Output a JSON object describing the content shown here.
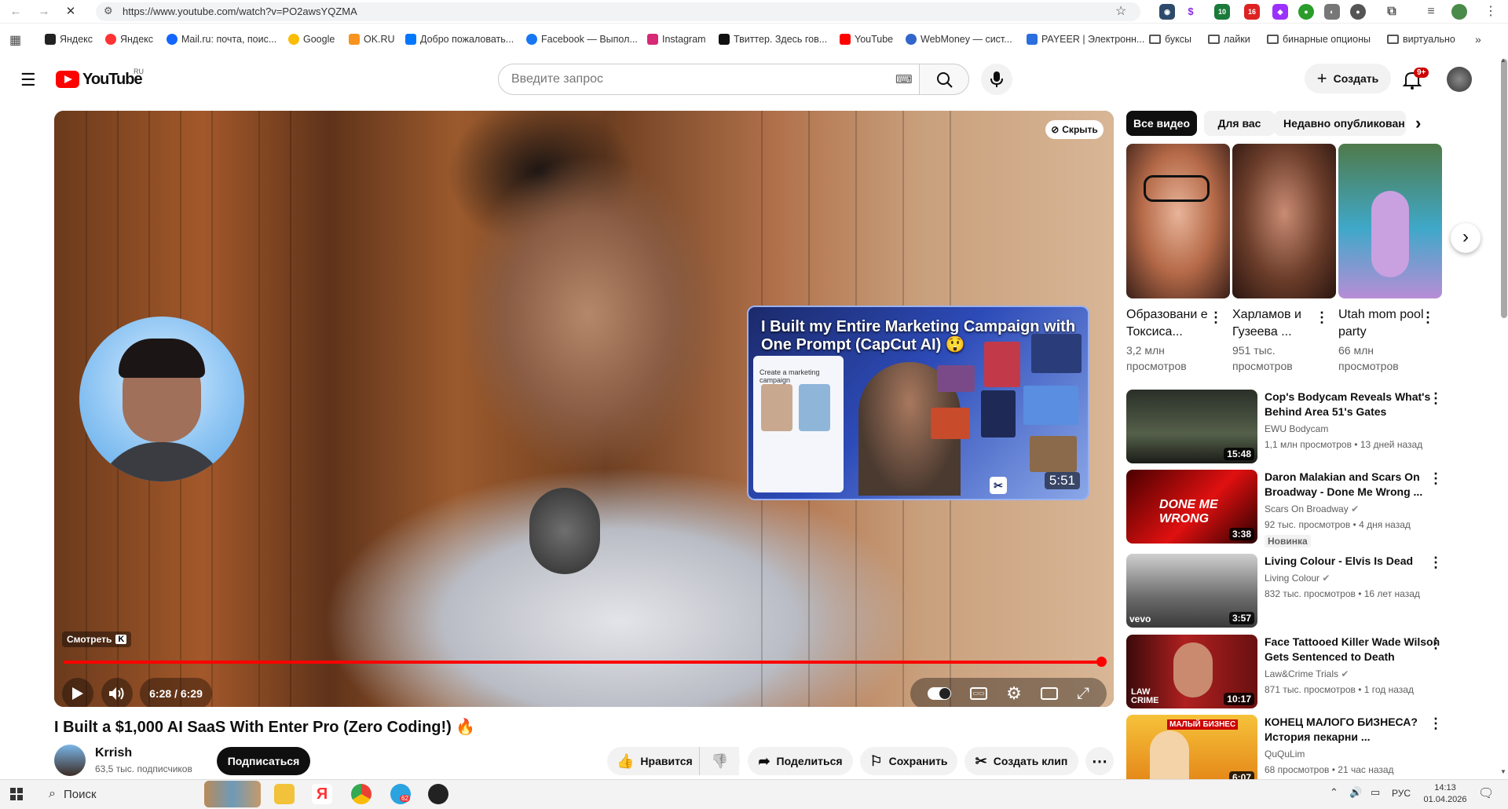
{
  "browser": {
    "url": "https://www.youtube.com/watch?v=PO2awsYQZMA",
    "bookmarks": [
      "Яндекс",
      "Яндекс",
      "Mail.ru: почта, поис...",
      "Google",
      "OK.RU",
      "Добро пожаловать...",
      "Facebook — Выпол...",
      "Instagram",
      "Твиттер. Здесь гов...",
      "YouTube",
      "WebMoney — сист...",
      "PAYEER | Электронн...",
      "буксы",
      "лайки",
      "бинарные опционы",
      "виртуально"
    ],
    "ext_badges": [
      "10",
      "16"
    ]
  },
  "header": {
    "logo_text": "YouTube",
    "logo_region": "RU",
    "search_placeholder": "Введите запрос",
    "create_label": "Создать",
    "notif_badge": "9+"
  },
  "player": {
    "hide_label": "Скрыть",
    "watch_label": "Смотреть",
    "watch_key": "K",
    "time": "6:28 / 6:29",
    "endcard_title": "I Built my Entire Marketing Campaign with One Prompt (CapCut AI) 😲",
    "endcard_duration": "5:51",
    "endcard_panel_text": "Create a marketing campaign",
    "progress": 0.997
  },
  "video": {
    "title": "I Built a $1,000 AI SaaS With Enter Pro (Zero Coding!) 🔥",
    "channel": "Krrish",
    "subscribers": "63,5 тыс. подписчиков",
    "subscribe_label": "Подписаться",
    "like_label": "Нравится",
    "share_label": "Поделиться",
    "save_label": "Сохранить",
    "clip_label": "Создать клип"
  },
  "sidebar": {
    "chips": [
      "Все видео",
      "Для вас",
      "Недавно опубликован"
    ],
    "shorts": [
      {
        "title": "Образовани е Токсиса...",
        "meta": "3,2 млн просмотров"
      },
      {
        "title": "Харламов и Гузеева ...",
        "meta": "951 тыс. просмотров"
      },
      {
        "title": "Utah mom pool party",
        "meta": "66 млн просмотров"
      }
    ],
    "recs": [
      {
        "title": "Cop's Bodycam Reveals What's Behind Area 51's Gates",
        "channel": "EWU Bodycam",
        "meta": "1,1 млн просмотров • 13 дней назад",
        "duration": "15:48",
        "badge": ""
      },
      {
        "title": "Daron Malakian and Scars On Broadway - Done Me Wrong ...",
        "channel": "Scars On Broadway",
        "meta": "92 тыс. просмотров • 4 дня назад",
        "duration": "3:38",
        "badge": "Новинка"
      },
      {
        "title": "Living Colour - Elvis Is Dead",
        "channel": "Living Colour",
        "meta": "832 тыс. просмотров • 16 лет назад",
        "duration": "3:57",
        "badge": ""
      },
      {
        "title": "Face Tattooed Killer Wade Wilson Gets Sentenced to Death",
        "channel": "Law&Crime Trials",
        "meta": "871 тыс. просмотров • 1 год назад",
        "duration": "10:17",
        "badge": ""
      },
      {
        "title": "КОНЕЦ МАЛОГО БИЗНЕСА? История пекарни ...",
        "channel": "QuQuLim",
        "meta": "68 просмотров • 21 час назад",
        "duration": "6:07",
        "badge": ""
      }
    ],
    "thumb_texts": [
      "DONE ME WRONG",
      "LAW CRIME",
      "vevo",
      "МАЛЫЙ БИЗНЕС"
    ]
  },
  "taskbar": {
    "search_label": "Поиск",
    "telegram_badge": "62",
    "lang": "РУС",
    "time": "14:13",
    "date": "01.04.2026"
  }
}
